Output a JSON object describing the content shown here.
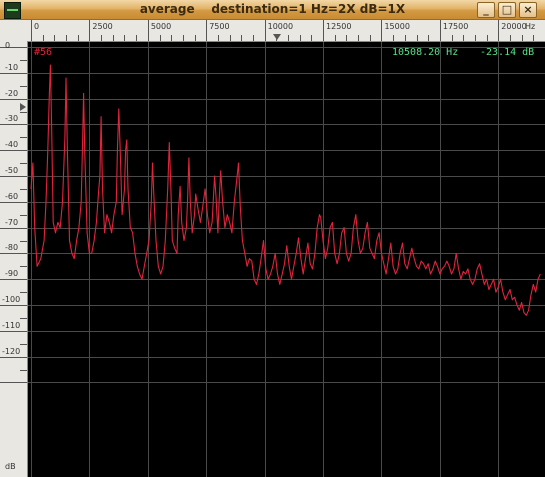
{
  "window": {
    "title": "average    destination=1 Hz=2X dB=1X",
    "buttons": {
      "minimize": "_",
      "maximize": "□",
      "close": "×"
    }
  },
  "readout": {
    "peak_label": "#56",
    "frequency": "10508.20 Hz",
    "level": "-23.14 dB"
  },
  "colors": {
    "plot_bg": "#000000",
    "grid": "#4a4a4a",
    "trace": "#e0243c",
    "readout": "#58e08a"
  },
  "chart_data": {
    "type": "line",
    "xlim": [
      0,
      22000
    ],
    "ylim": [
      -135,
      0
    ],
    "x_ticks": [
      "0",
      "2500",
      "5000",
      "7500",
      "10000",
      "12500",
      "15000",
      "17500",
      "20000",
      "Hz"
    ],
    "y_ticks": [
      "0",
      "-10",
      "-20",
      "-30",
      "-40",
      "-50",
      "-60",
      "-70",
      "-80",
      "-90",
      "-100",
      "-110",
      "-120",
      "dB"
    ],
    "grid": true,
    "series": [
      {
        "points": [
          [
            0,
            -55
          ],
          [
            80,
            -45
          ],
          [
            160,
            -70
          ],
          [
            260,
            -85
          ],
          [
            420,
            -82
          ],
          [
            560,
            -75
          ],
          [
            640,
            -60
          ],
          [
            720,
            -40
          ],
          [
            780,
            -20
          ],
          [
            830,
            -7
          ],
          [
            880,
            -30
          ],
          [
            950,
            -68
          ],
          [
            1050,
            -72
          ],
          [
            1150,
            -68
          ],
          [
            1250,
            -70
          ],
          [
            1350,
            -60
          ],
          [
            1450,
            -35
          ],
          [
            1500,
            -12
          ],
          [
            1560,
            -40
          ],
          [
            1650,
            -75
          ],
          [
            1750,
            -80
          ],
          [
            1850,
            -82
          ],
          [
            1950,
            -75
          ],
          [
            2050,
            -70
          ],
          [
            2150,
            -60
          ],
          [
            2200,
            -40
          ],
          [
            2250,
            -18
          ],
          [
            2300,
            -40
          ],
          [
            2400,
            -72
          ],
          [
            2500,
            -80
          ],
          [
            2600,
            -80
          ],
          [
            2700,
            -75
          ],
          [
            2800,
            -68
          ],
          [
            2900,
            -55
          ],
          [
            2950,
            -50
          ],
          [
            3000,
            -27
          ],
          [
            3060,
            -55
          ],
          [
            3150,
            -72
          ],
          [
            3250,
            -65
          ],
          [
            3350,
            -68
          ],
          [
            3450,
            -72
          ],
          [
            3550,
            -65
          ],
          [
            3650,
            -60
          ],
          [
            3700,
            -40
          ],
          [
            3760,
            -24
          ],
          [
            3820,
            -40
          ],
          [
            3900,
            -65
          ],
          [
            4000,
            -55
          ],
          [
            4050,
            -40
          ],
          [
            4100,
            -36
          ],
          [
            4150,
            -55
          ],
          [
            4250,
            -70
          ],
          [
            4350,
            -72
          ],
          [
            4450,
            -80
          ],
          [
            4550,
            -85
          ],
          [
            4650,
            -88
          ],
          [
            4750,
            -90
          ],
          [
            4850,
            -85
          ],
          [
            4950,
            -80
          ],
          [
            5050,
            -75
          ],
          [
            5150,
            -60
          ],
          [
            5200,
            -45
          ],
          [
            5260,
            -58
          ],
          [
            5350,
            -75
          ],
          [
            5450,
            -85
          ],
          [
            5550,
            -88
          ],
          [
            5650,
            -85
          ],
          [
            5750,
            -75
          ],
          [
            5850,
            -55
          ],
          [
            5920,
            -37
          ],
          [
            5990,
            -55
          ],
          [
            6050,
            -75
          ],
          [
            6150,
            -78
          ],
          [
            6250,
            -80
          ],
          [
            6300,
            -65
          ],
          [
            6380,
            -54
          ],
          [
            6450,
            -68
          ],
          [
            6550,
            -75
          ],
          [
            6650,
            -70
          ],
          [
            6700,
            -60
          ],
          [
            6760,
            -43
          ],
          [
            6820,
            -60
          ],
          [
            6900,
            -72
          ],
          [
            7000,
            -65
          ],
          [
            7050,
            -57
          ],
          [
            7150,
            -63
          ],
          [
            7250,
            -68
          ],
          [
            7350,
            -62
          ],
          [
            7450,
            -55
          ],
          [
            7550,
            -65
          ],
          [
            7650,
            -72
          ],
          [
            7750,
            -68
          ],
          [
            7800,
            -60
          ],
          [
            7860,
            -50
          ],
          [
            7920,
            -58
          ],
          [
            8000,
            -72
          ],
          [
            8050,
            -60
          ],
          [
            8120,
            -48
          ],
          [
            8200,
            -60
          ],
          [
            8300,
            -70
          ],
          [
            8400,
            -65
          ],
          [
            8500,
            -68
          ],
          [
            8600,
            -72
          ],
          [
            8700,
            -60
          ],
          [
            8800,
            -52
          ],
          [
            8880,
            -45
          ],
          [
            8960,
            -62
          ],
          [
            9050,
            -75
          ],
          [
            9150,
            -80
          ],
          [
            9250,
            -85
          ],
          [
            9350,
            -82
          ],
          [
            9450,
            -83
          ],
          [
            9550,
            -90
          ],
          [
            9650,
            -92
          ],
          [
            9750,
            -88
          ],
          [
            9850,
            -82
          ],
          [
            9950,
            -75
          ],
          [
            10050,
            -86
          ],
          [
            10150,
            -90
          ],
          [
            10250,
            -88
          ],
          [
            10350,
            -85
          ],
          [
            10450,
            -80
          ],
          [
            10550,
            -88
          ],
          [
            10650,
            -92
          ],
          [
            10750,
            -88
          ],
          [
            10850,
            -84
          ],
          [
            10950,
            -77
          ],
          [
            11050,
            -85
          ],
          [
            11150,
            -90
          ],
          [
            11250,
            -85
          ],
          [
            11350,
            -80
          ],
          [
            11450,
            -74
          ],
          [
            11550,
            -82
          ],
          [
            11650,
            -88
          ],
          [
            11750,
            -82
          ],
          [
            11850,
            -76
          ],
          [
            11950,
            -84
          ],
          [
            12050,
            -86
          ],
          [
            12150,
            -80
          ],
          [
            12250,
            -70
          ],
          [
            12350,
            -65
          ],
          [
            12400,
            -66
          ],
          [
            12500,
            -75
          ],
          [
            12600,
            -82
          ],
          [
            12700,
            -78
          ],
          [
            12800,
            -70
          ],
          [
            12900,
            -68
          ],
          [
            13000,
            -80
          ],
          [
            13100,
            -84
          ],
          [
            13200,
            -80
          ],
          [
            13300,
            -72
          ],
          [
            13400,
            -70
          ],
          [
            13500,
            -80
          ],
          [
            13600,
            -83
          ],
          [
            13700,
            -80
          ],
          [
            13800,
            -70
          ],
          [
            13900,
            -65
          ],
          [
            14000,
            -75
          ],
          [
            14100,
            -80
          ],
          [
            14200,
            -78
          ],
          [
            14300,
            -72
          ],
          [
            14400,
            -68
          ],
          [
            14500,
            -78
          ],
          [
            14600,
            -80
          ],
          [
            14700,
            -82
          ],
          [
            14800,
            -75
          ],
          [
            14900,
            -72
          ],
          [
            15000,
            -80
          ],
          [
            15100,
            -84
          ],
          [
            15200,
            -88
          ],
          [
            15300,
            -82
          ],
          [
            15400,
            -76
          ],
          [
            15500,
            -85
          ],
          [
            15600,
            -88
          ],
          [
            15700,
            -86
          ],
          [
            15800,
            -80
          ],
          [
            15900,
            -76
          ],
          [
            16000,
            -84
          ],
          [
            16100,
            -86
          ],
          [
            16200,
            -82
          ],
          [
            16300,
            -78
          ],
          [
            16400,
            -82
          ],
          [
            16500,
            -85
          ],
          [
            16600,
            -86
          ],
          [
            16700,
            -83
          ],
          [
            16800,
            -84
          ],
          [
            16900,
            -86
          ],
          [
            17000,
            -84
          ],
          [
            17100,
            -88
          ],
          [
            17200,
            -86
          ],
          [
            17300,
            -83
          ],
          [
            17400,
            -85
          ],
          [
            17500,
            -88
          ],
          [
            17600,
            -86
          ],
          [
            17700,
            -85
          ],
          [
            17800,
            -83
          ],
          [
            17900,
            -85
          ],
          [
            18000,
            -88
          ],
          [
            18100,
            -86
          ],
          [
            18200,
            -80
          ],
          [
            18300,
            -86
          ],
          [
            18400,
            -90
          ],
          [
            18500,
            -87
          ],
          [
            18600,
            -88
          ],
          [
            18700,
            -86
          ],
          [
            18800,
            -90
          ],
          [
            18900,
            -92
          ],
          [
            19000,
            -90
          ],
          [
            19100,
            -86
          ],
          [
            19200,
            -84
          ],
          [
            19300,
            -88
          ],
          [
            19400,
            -92
          ],
          [
            19500,
            -90
          ],
          [
            19600,
            -94
          ],
          [
            19700,
            -92
          ],
          [
            19800,
            -90
          ],
          [
            19900,
            -95
          ],
          [
            20000,
            -93
          ],
          [
            20100,
            -90
          ],
          [
            20200,
            -95
          ],
          [
            20300,
            -98
          ],
          [
            20400,
            -96
          ],
          [
            20500,
            -94
          ],
          [
            20600,
            -98
          ],
          [
            20700,
            -97
          ],
          [
            20800,
            -100
          ],
          [
            20900,
            -102
          ],
          [
            21000,
            -99
          ],
          [
            21100,
            -103
          ],
          [
            21200,
            -104
          ],
          [
            21300,
            -102
          ],
          [
            21400,
            -96
          ],
          [
            21500,
            -92
          ],
          [
            21600,
            -95
          ],
          [
            21700,
            -90
          ],
          [
            21800,
            -88
          ]
        ]
      }
    ]
  }
}
